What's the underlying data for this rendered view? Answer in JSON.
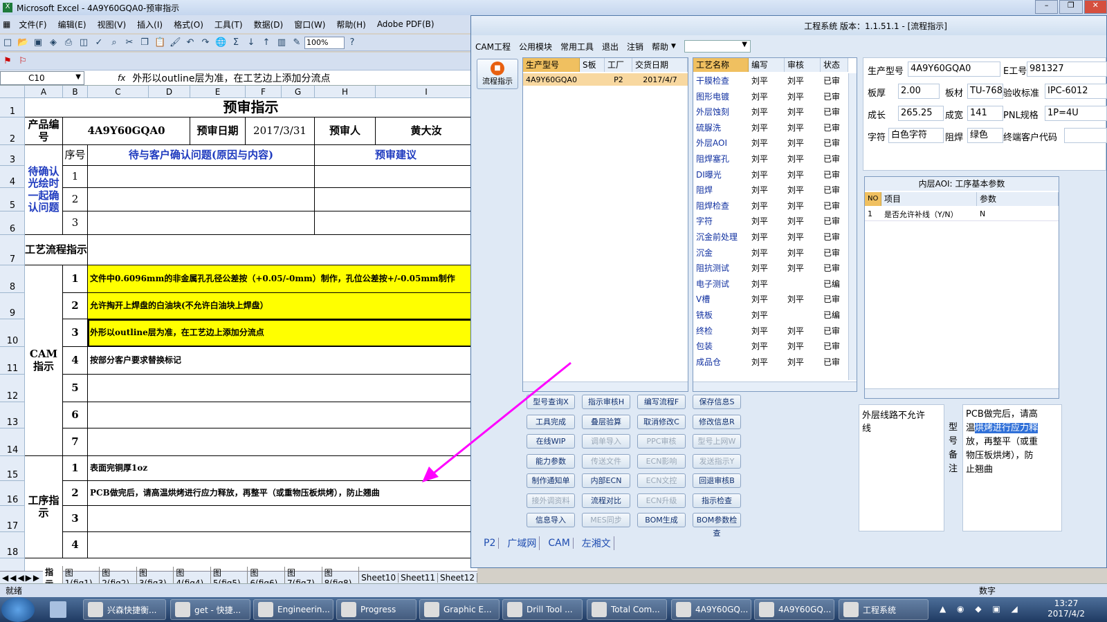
{
  "excel": {
    "title": "Microsoft Excel - 4A9Y60GQA0-预审指示",
    "menu": [
      "文件(F)",
      "编辑(E)",
      "视图(V)",
      "插入(I)",
      "格式(O)",
      "工具(T)",
      "数据(D)",
      "窗口(W)",
      "帮助(H)",
      "Adobe PDF(B)"
    ],
    "zoom": "100%",
    "name_box": "C10",
    "fx": "fx",
    "formula": "外形以outline层为准，在工艺边上添加分流点",
    "columns": [
      "A",
      "B",
      "C",
      "D",
      "E",
      "F",
      "G",
      "H",
      "I"
    ],
    "rows": [
      "1",
      "2",
      "3",
      "4",
      "5",
      "6",
      "7",
      "8",
      "9",
      "10",
      "11",
      "12",
      "13",
      "14",
      "15",
      "16",
      "17",
      "18"
    ],
    "sheet": {
      "title": "预审指示",
      "product_label": "产品编号",
      "product_value": "4A9Y60GQA0",
      "date_label": "预审日期",
      "date_value": "2017/3/31",
      "reviewer_label": "预审人",
      "reviewer_value": "黄大汝",
      "seq_label": "序号",
      "issues_header": "待与客户确认问题(原因与内容)",
      "suggest_header": "预审建议",
      "confirm_label": "待确认光绘时一起确认问题",
      "flow_label": "工艺流程指示",
      "cam_label": "CAM指示",
      "proc_label": "工序指示",
      "confirm_nums": [
        "1",
        "2",
        "3"
      ],
      "cam_nums": [
        "1",
        "2",
        "3",
        "4",
        "5",
        "6",
        "7"
      ],
      "cam_items": [
        "文件中0.6096mm的非金属孔孔径公差按（+0.05/-0mm）制作，孔位公差按+/-0.05mm制作",
        "允许掏开上焊盘的白油块(不允许白油块上焊盘）",
        "外形以outline层为准，在工艺边上添加分流点",
        "按部分客户要求替换标记",
        "",
        "",
        ""
      ],
      "proc_nums": [
        "1",
        "2",
        "3",
        "4"
      ],
      "proc_items": [
        "表面完铜厚1oz",
        "PCB做完后，请高温烘烤进行应力释放，再整平（或重物压板烘烤），防止翘曲",
        "",
        ""
      ]
    },
    "sheet_tabs": [
      "指示",
      "图1(fig1)",
      "图2(fig2)",
      "图3(fig3)",
      "图4(fig4)",
      "图5(fig5)",
      "图6(fig6)",
      "图7(fig7)",
      "图8(fig8)",
      "Sheet10",
      "Sheet11",
      "Sheet12"
    ],
    "status": "就绪",
    "status_right": "数字"
  },
  "eng": {
    "title": "工程系统  版本：1.1.51.1 - [流程指示]",
    "menu": [
      "CAM工程",
      "公用模块",
      "常用工具",
      "退出",
      "注销",
      "帮助"
    ],
    "side_button": "流程指示",
    "order_headers": [
      "生产型号",
      "S板",
      "工厂",
      "交货日期"
    ],
    "order_row": [
      "4A9Y60GQA0",
      "",
      "P2",
      "2017/4/7"
    ],
    "proc_headers": [
      "工艺名称",
      "编写",
      "审核",
      "状态"
    ],
    "processes": [
      [
        "干膜检查",
        "刘平",
        "刘平",
        "已审"
      ],
      [
        "图形电镀",
        "刘平",
        "刘平",
        "已审"
      ],
      [
        "外层蚀刻",
        "刘平",
        "刘平",
        "已审"
      ],
      [
        "硫脲洗",
        "刘平",
        "刘平",
        "已审"
      ],
      [
        "外层AOI",
        "刘平",
        "刘平",
        "已审"
      ],
      [
        "阻焊塞孔",
        "刘平",
        "刘平",
        "已审"
      ],
      [
        "DI曝光",
        "刘平",
        "刘平",
        "已审"
      ],
      [
        "阻焊",
        "刘平",
        "刘平",
        "已审"
      ],
      [
        "阻焊检查",
        "刘平",
        "刘平",
        "已审"
      ],
      [
        "字符",
        "刘平",
        "刘平",
        "已审"
      ],
      [
        "沉金前处理",
        "刘平",
        "刘平",
        "已审"
      ],
      [
        "沉金",
        "刘平",
        "刘平",
        "已审"
      ],
      [
        "阻抗测试",
        "刘平",
        "刘平",
        "已审"
      ],
      [
        "电子测试",
        "刘平",
        "",
        "已编"
      ],
      [
        "V槽",
        "刘平",
        "刘平",
        "已审"
      ],
      [
        "铣板",
        "刘平",
        "",
        "已编"
      ],
      [
        "终检",
        "刘平",
        "刘平",
        "已审"
      ],
      [
        "包装",
        "刘平",
        "刘平",
        "已审"
      ],
      [
        "成品仓",
        "刘平",
        "刘平",
        "已审"
      ]
    ],
    "info": {
      "model_label": "生产型号",
      "model": "4A9Y60GQA0",
      "e_label": "E工号",
      "e": "981327",
      "thick_label": "板厚",
      "thick": "2.00",
      "mat_label": "板材",
      "mat": "TU-768",
      "std_label": "验收标准",
      "std": "IPC-6012",
      "len_label": "成长",
      "len": "265.25",
      "wid_label": "成宽",
      "wid": "141",
      "pnl_label": "PNL规格",
      "pnl": "1P=4U",
      "char_label": "字符",
      "char": "白色字符",
      "mask_label": "阻焊",
      "mask": "绿色",
      "cust_label": "终端客户代码"
    },
    "params": {
      "title": "内层AOI: 工序基本参数",
      "headers": [
        "NO",
        "项目",
        "参数"
      ],
      "row": [
        "1",
        "是否允许补线（Y/N）",
        "N"
      ]
    },
    "buttons": [
      {
        "label": "型号查询X",
        "on": true
      },
      {
        "label": "指示审核H",
        "on": true
      },
      {
        "label": "编写流程F",
        "on": true
      },
      {
        "label": "保存信息S",
        "on": true
      },
      {
        "label": "工具完成",
        "on": true
      },
      {
        "label": "叠层验算",
        "on": true
      },
      {
        "label": "取消修改C",
        "on": true
      },
      {
        "label": "修改信息R",
        "on": true
      },
      {
        "label": "在线WIP",
        "on": true
      },
      {
        "label": "调单导入",
        "on": false
      },
      {
        "label": "PPC审核",
        "on": false
      },
      {
        "label": "型号上网W",
        "on": false
      },
      {
        "label": "能力参数",
        "on": true
      },
      {
        "label": "传送文件",
        "on": false
      },
      {
        "label": "ECN影响",
        "on": false
      },
      {
        "label": "发送指示Y",
        "on": false
      },
      {
        "label": "制作通知单",
        "on": true
      },
      {
        "label": "内部ECN",
        "on": true
      },
      {
        "label": "ECN文控",
        "on": false
      },
      {
        "label": "回退审核B",
        "on": true
      },
      {
        "label": "接外调资料",
        "on": false
      },
      {
        "label": "流程对比",
        "on": true
      },
      {
        "label": "ECN升级",
        "on": false
      },
      {
        "label": "指示检查",
        "on": true
      },
      {
        "label": "信息导入",
        "on": true
      },
      {
        "label": "MES同步",
        "on": false
      },
      {
        "label": "BOM生成",
        "on": true
      },
      {
        "label": "BOM参数检查",
        "on": true
      }
    ],
    "note_left": "外层线路不允许",
    "note_left2": "线",
    "note_label": "型号备注",
    "note_lines": [
      "PCB做完后，请高",
      "温",
      "烘烤进行应力释",
      "放，再整平（或重",
      "物压板烘烤），防",
      "止翘曲"
    ],
    "bottom_tabs": [
      "P2",
      "广域网",
      "CAM",
      "左湘文"
    ]
  },
  "taskbar": {
    "tasks": [
      "兴森快捷衡...",
      "get - 快捷...",
      "Engineerin...",
      "Progress",
      "Graphic E...",
      "Drill Tool ...",
      "Total Com...",
      "4A9Y60GQ...",
      "4A9Y60GQ...",
      "工程系统"
    ],
    "time": "13:27",
    "date": "2017/4/2"
  },
  "colors": {
    "yellow": "#ffff00",
    "header_orange": "#f0c060",
    "annotation_arrow": "#ff00ff",
    "blue_text": "#1f3bbf"
  }
}
